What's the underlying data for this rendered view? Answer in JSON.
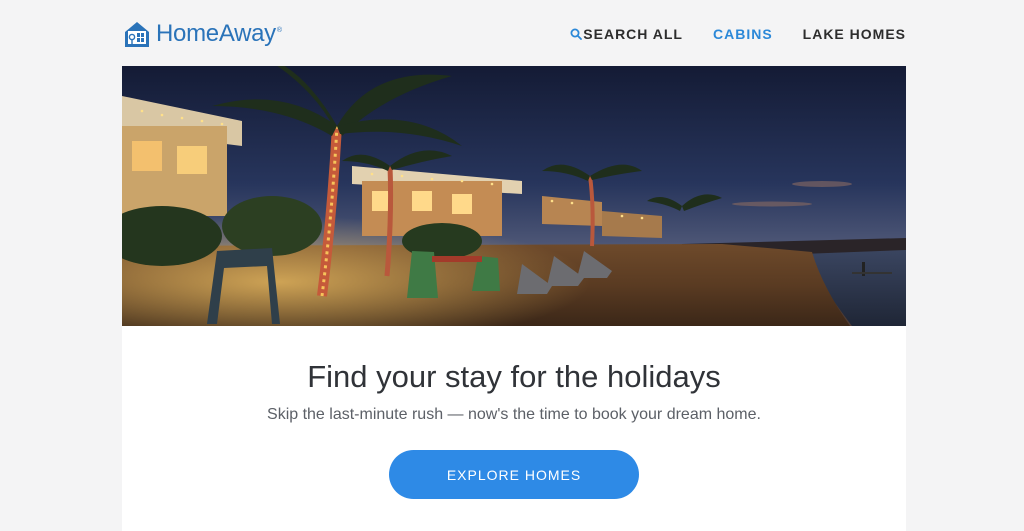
{
  "header": {
    "logo_text": "HomeAway",
    "logo_mark": "®",
    "nav": [
      {
        "label": "SEARCH ALL",
        "icon": "search-icon"
      },
      {
        "label": "CABINS",
        "active": true
      },
      {
        "label": "LAKE HOMES"
      }
    ]
  },
  "hero": {
    "image": "beach-cottages-holiday-lights-night"
  },
  "content": {
    "headline": "Find your stay for the holidays",
    "subline": "Skip the last-minute rush — now's the time to book your dream home.",
    "cta_label": "EXPLORE HOMES"
  },
  "colors": {
    "brand": "#2a73b9",
    "accent": "#2e8ae6",
    "nav_active": "#2b88d8",
    "background": "#f4f4f5"
  }
}
